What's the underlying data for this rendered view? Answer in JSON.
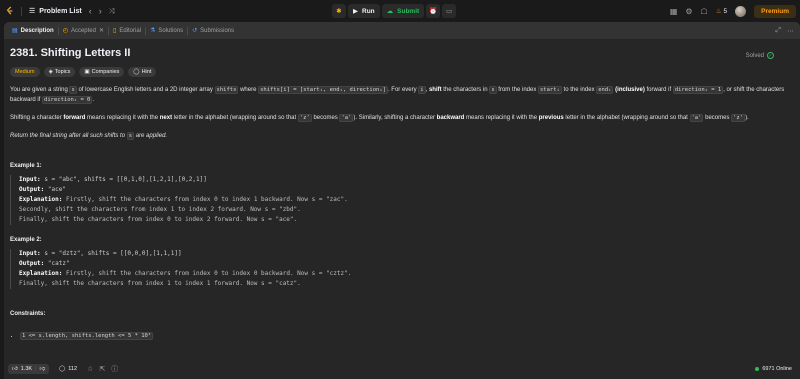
{
  "topbar": {
    "problem_list_label": "Problem List",
    "run_label": "Run",
    "submit_label": "Submit",
    "streak_count": "5",
    "premium_label": "Premium"
  },
  "tabs": {
    "description": "Description",
    "accepted": "Accepted",
    "editorial": "Editorial",
    "solutions": "Solutions",
    "submissions": "Submissions"
  },
  "problem": {
    "title": "2381. Shifting Letters II",
    "status": "Solved",
    "difficulty": "Medium",
    "topics_label": "Topics",
    "companies_label": "Companies",
    "hint_label": "Hint"
  },
  "description": {
    "p1_a": "You are given a string ",
    "p1_s": "s",
    "p1_b": " of lowercase English letters and a 2D integer array ",
    "p1_shifts": "shifts",
    "p1_c": " where ",
    "p1_shifts_i": "shifts[i] = [startᵢ, endᵢ, directionᵢ]",
    "p1_d": ". For every ",
    "p1_i": "i",
    "p1_e": ", ",
    "p1_shift": "shift",
    "p1_f": " the characters in ",
    "p1_s2": "s",
    "p1_g": " from the index ",
    "p1_start": "startᵢ",
    "p1_h": " to the index ",
    "p1_end": "endᵢ",
    "p1_i2": " ",
    "p1_incl": "(inclusive)",
    "p1_j": " forward if ",
    "p1_dir1": "directionᵢ = 1",
    "p1_k": ", or shift the characters backward if ",
    "p1_dir0": "directionᵢ = 0",
    "p1_l": ".",
    "p2_a": "Shifting a character ",
    "p2_forward": "forward",
    "p2_b": " means replacing it with the ",
    "p2_next": "next",
    "p2_c": " letter in the alphabet (wrapping around so that ",
    "p2_z": "'z'",
    "p2_d": " becomes ",
    "p2_a_char": "'a'",
    "p2_e": "). Similarly, shifting a character ",
    "p2_backward": "backward",
    "p2_f": " means replacing it with the ",
    "p2_previous": "previous",
    "p2_g": " letter in the alphabet (wrapping around so that ",
    "p2_a2": "'a'",
    "p2_h": " becomes ",
    "p2_z2": "'z'",
    "p2_i": ").",
    "p3_a": "Return the final string after all such shifts to ",
    "p3_s": "s",
    "p3_b": " are applied."
  },
  "examples": [
    {
      "heading": "Example 1:",
      "input_key": "Input:",
      "input_val": "s = \"abc\", shifts = [[0,1,0],[1,2,1],[0,2,1]]",
      "output_key": "Output:",
      "output_val": "\"ace\"",
      "expl_key": "Explanation:",
      "expl_lines": [
        "Firstly, shift the characters from index 0 to index 1 backward. Now s = \"zac\".",
        "Secondly, shift the characters from index 1 to index 2 forward. Now s = \"zbd\".",
        "Finally, shift the characters from index 0 to index 2 forward. Now s = \"ace\"."
      ]
    },
    {
      "heading": "Example 2:",
      "input_key": "Input:",
      "input_val": "s = \"dztz\", shifts = [[0,0,0],[1,1,1]]",
      "output_key": "Output:",
      "output_val": "\"catz\"",
      "expl_key": "Explanation:",
      "expl_lines": [
        "Firstly, shift the characters from index 0 to index 0 backward. Now s = \"cztz\".",
        "Finally, shift the characters from index 1 to index 1 forward. Now s = \"catz\"."
      ]
    }
  ],
  "constraints": {
    "heading": "Constraints:",
    "item1": "1 <= s.length, shifts.length <= 5 * 10⁴"
  },
  "bottom": {
    "likes": "1.3K",
    "comments": "112",
    "online": "6971 Online"
  },
  "colors": {
    "accent_orange": "#ffa116",
    "medium": "#ffb800",
    "green": "#2cbb5d",
    "blue": "#5ea1ff"
  }
}
